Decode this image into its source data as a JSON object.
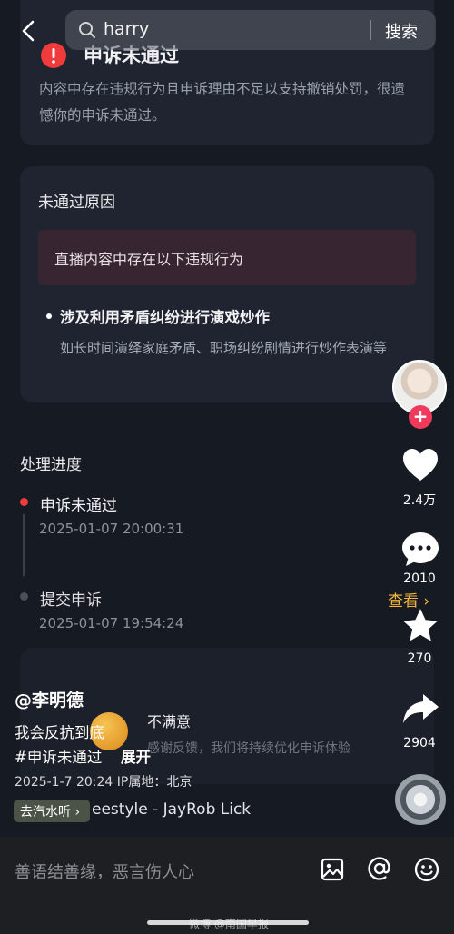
{
  "header": {
    "search_query": "harry",
    "search_button": "搜索"
  },
  "appeal": {
    "status_title": "申诉未通过",
    "status_desc": "内容中存在违规行为且申诉理由不足以支持撤销处罚，很遗憾你的申诉未通过。"
  },
  "reason": {
    "title": "未通过原因",
    "violation": "直播内容中存在以下违规行为",
    "item_title": "涉及利用矛盾纠纷进行演戏炒作",
    "item_desc": "如长时间演绎家庭矛盾、职场纠纷剧情进行炒作表演等"
  },
  "progress": {
    "title": "处理进度",
    "steps": [
      {
        "label": "申诉未通过",
        "time": "2025-01-07 20:00:31"
      },
      {
        "label": "提交申诉",
        "time": "2025-01-07 19:54:24"
      }
    ],
    "view_link": "查看 ›"
  },
  "feedback": {
    "title": "不满意",
    "desc": "感谢反馈，我们将持续优化申诉体验"
  },
  "post": {
    "author": "@李明德",
    "caption": "我会反抗到底",
    "hashtag": "#申诉未通过",
    "expand": "展开",
    "meta": "2025-1-7 20:24  IP属地：北京"
  },
  "music": {
    "pill_label": "去汽水听 ›",
    "track": "eestyle - JayRob    Lick"
  },
  "sidebar": {
    "likes": "2.4万",
    "comments": "2010",
    "favorites": "270",
    "shares": "2904"
  },
  "bottom": {
    "comment_placeholder": "善语结善缘，恶言伤人心"
  },
  "watermark": "微博 @南国早报",
  "colors": {
    "background": "#161a23",
    "card": "#1f2430",
    "alert_red": "#ef3b3b",
    "link_yellow": "#f5b63b",
    "follow_pink": "#f03a5b"
  }
}
